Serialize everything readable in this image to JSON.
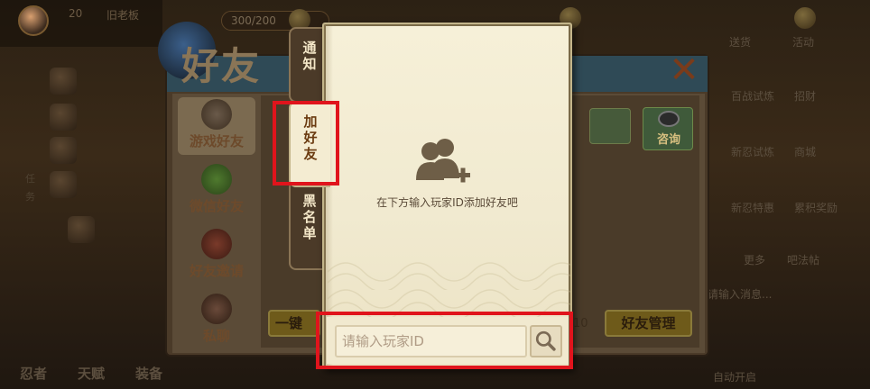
{
  "hud": {
    "level": "20",
    "player_name": "旧老板",
    "energy": "300/200",
    "top_right_labels": [
      "活动",
      "送货"
    ],
    "side_left_labels": [
      "任",
      "务"
    ],
    "bottom_left_labels": [
      "忍者",
      "天赋",
      "装备"
    ],
    "right_column_labels": [
      "百战试炼",
      "招财",
      "新忍试炼",
      "商城",
      "新忍特惠",
      "累积奖励",
      "更多",
      "吧法帖"
    ],
    "chat_hint": "请输入消息...",
    "bottom_right_label": "自动开启"
  },
  "friend_window": {
    "title": "好友",
    "tabs": [
      {
        "label": "游戏好友"
      },
      {
        "label": "微信好友"
      },
      {
        "label": "好友邀请"
      },
      {
        "label": "私聊"
      }
    ],
    "consult_label": "咨询",
    "yijian_label": "一键",
    "count_text": "10",
    "manage_label": "好友管理"
  },
  "popup": {
    "side_tabs": [
      {
        "label": "通知"
      },
      {
        "label": "加好友"
      },
      {
        "label": "黑名单"
      }
    ],
    "empty_message": "在下方输入玩家ID添加好友吧",
    "search": {
      "placeholder": "请输入玩家ID"
    }
  },
  "colors": {
    "highlight": "#e0141c",
    "parchment": "#f4ecd2",
    "tab_dark": "#4b3a28"
  },
  "icons": {
    "add_friend": "add-friend-icon",
    "search": "search-icon",
    "close": "close-icon"
  }
}
